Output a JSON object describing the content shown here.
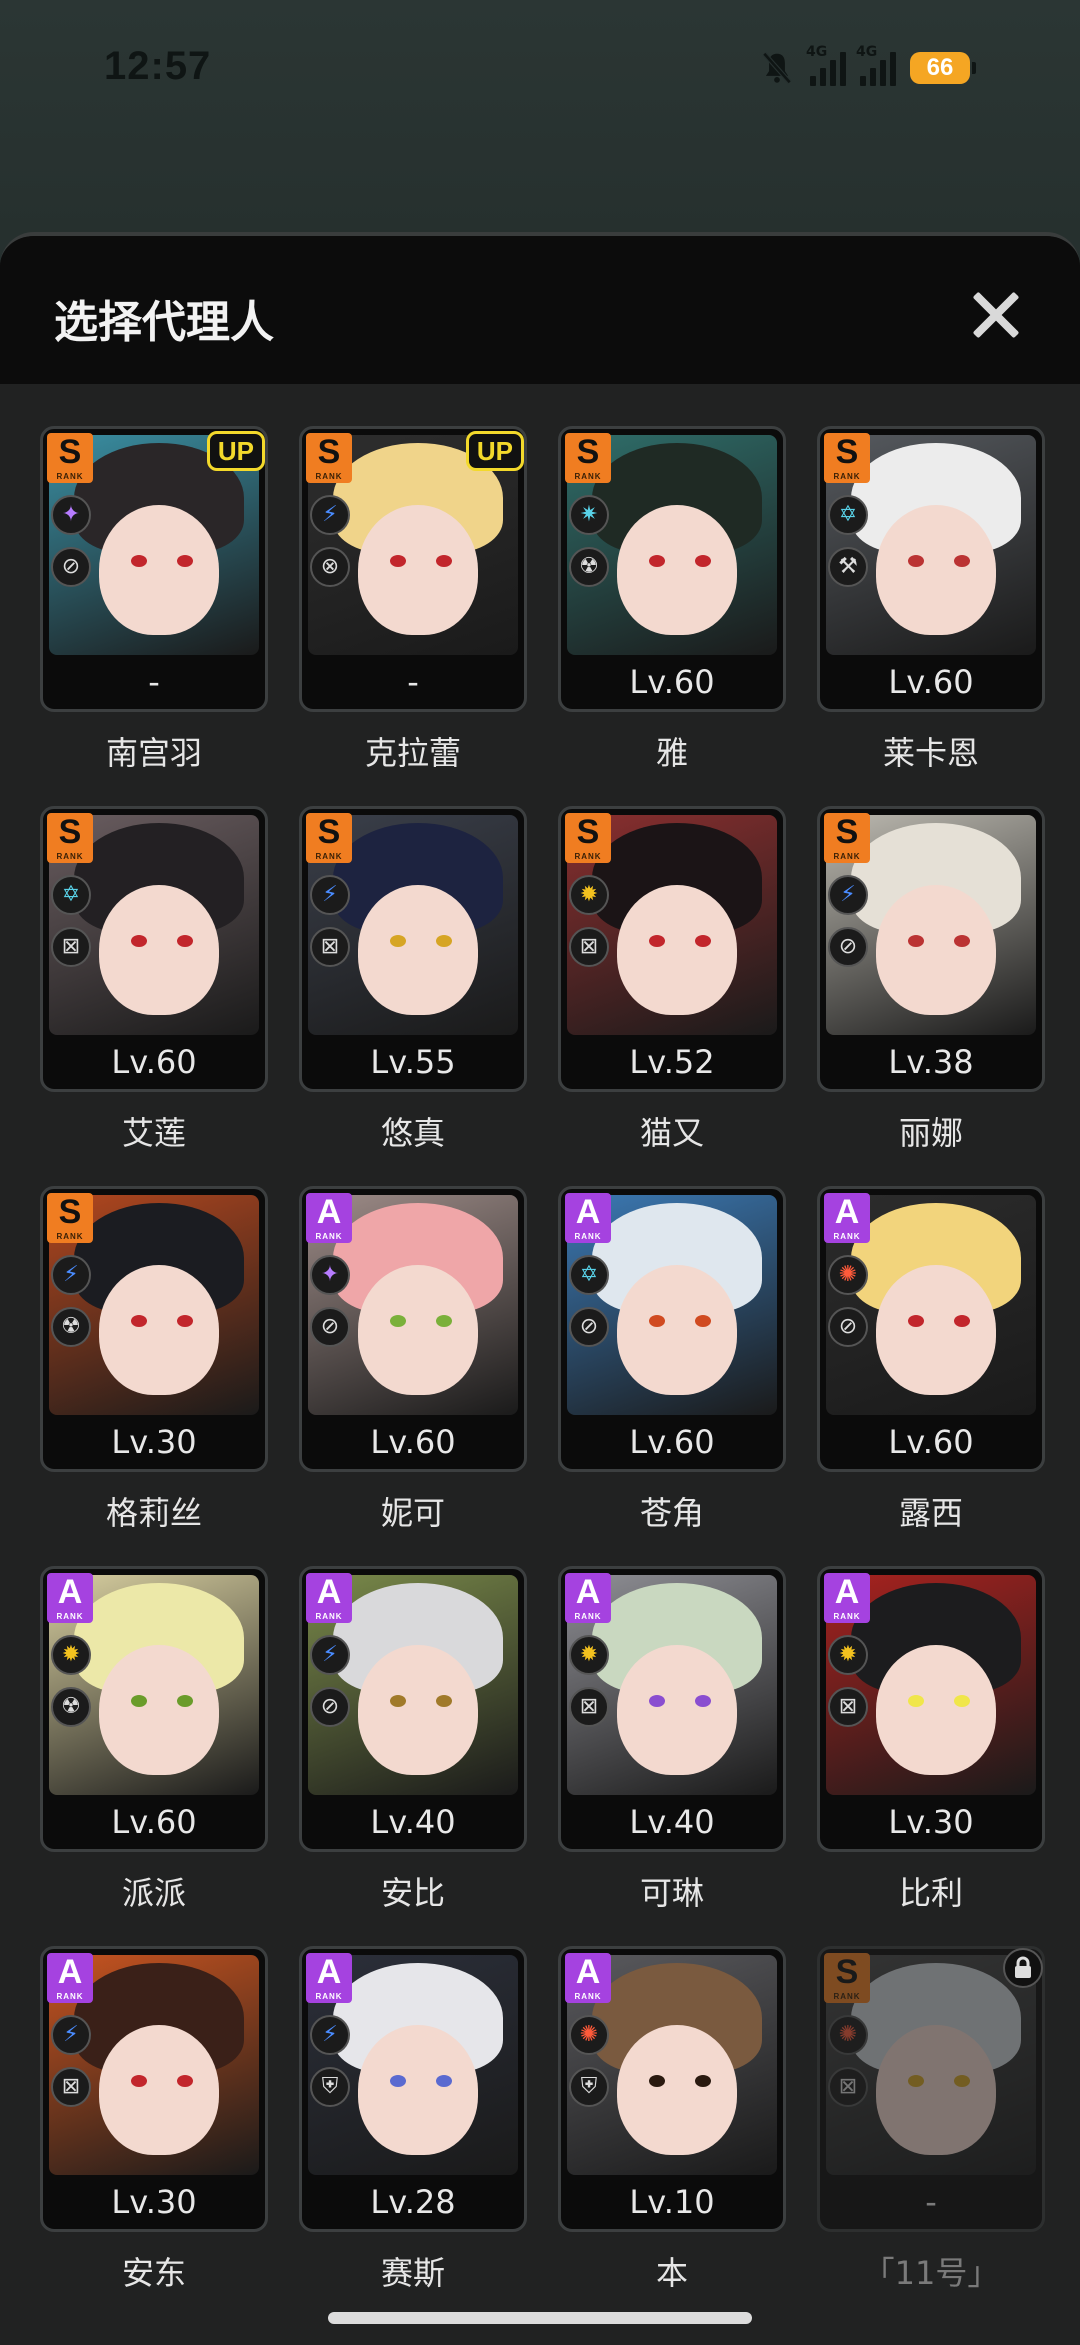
{
  "status_bar": {
    "time": "12:57",
    "network_1": "4G",
    "network_2": "4G",
    "battery": "66"
  },
  "panel": {
    "title": "选择代理人"
  },
  "agents": [
    {
      "name": "南宫羽",
      "level": "-",
      "rank": "S",
      "up": "UP",
      "attr_icon": "✦",
      "attr_color": "#b77cff",
      "spec_icon": "⊘",
      "hair": "#2a2628",
      "bg": "#3a8fa3",
      "eye": "#c2262c"
    },
    {
      "name": "克拉蕾",
      "level": "-",
      "rank": "S",
      "up": "UP",
      "attr_icon": "⚡",
      "attr_color": "#4a8cff",
      "spec_icon": "⊗",
      "hair": "#f0d48a",
      "bg": "#2e2e2e",
      "eye": "#c2262c"
    },
    {
      "name": "雅",
      "level": "Lv.60",
      "rank": "S",
      "attr_icon": "✷",
      "attr_color": "#59d2e8",
      "spec_icon": "☢",
      "hair": "#1f2a24",
      "bg": "#2f6e6a",
      "eye": "#c2262c"
    },
    {
      "name": "莱卡恩",
      "level": "Lv.60",
      "rank": "S",
      "attr_icon": "✡",
      "attr_color": "#59d2e8",
      "spec_icon": "⚒",
      "hair": "#ececec",
      "bg": "#565a5f",
      "eye": "#b33"
    },
    {
      "name": "艾莲",
      "level": "Lv.60",
      "rank": "S",
      "attr_icon": "✡",
      "attr_color": "#59d2e8",
      "spec_icon": "⊠",
      "hair": "#232023",
      "bg": "#6a5d60",
      "eye": "#c2262c"
    },
    {
      "name": "悠真",
      "level": "Lv.55",
      "rank": "S",
      "attr_icon": "⚡",
      "attr_color": "#4a8cff",
      "spec_icon": "⊠",
      "hair": "#1d2340",
      "bg": "#3a3f4a",
      "eye": "#d6a524"
    },
    {
      "name": "猫又",
      "level": "Lv.52",
      "rank": "S",
      "attr_icon": "✹",
      "attr_color": "#f3c21f",
      "spec_icon": "⊠",
      "hair": "#1b1416",
      "bg": "#8a2f2f",
      "eye": "#c2262c"
    },
    {
      "name": "丽娜",
      "level": "Lv.38",
      "rank": "S",
      "attr_icon": "⚡",
      "attr_color": "#4a8cff",
      "spec_icon": "⊘",
      "hair": "#e5e0d6",
      "bg": "#bcb9b0",
      "eye": "#b33"
    },
    {
      "name": "格莉丝",
      "level": "Lv.30",
      "rank": "S",
      "attr_icon": "⚡",
      "attr_color": "#4a8cff",
      "spec_icon": "☢",
      "hair": "#1b1c21",
      "bg": "#b2471f",
      "eye": "#c2262c"
    },
    {
      "name": "妮可",
      "level": "Lv.60",
      "rank": "A",
      "attr_icon": "✦",
      "attr_color": "#b77cff",
      "spec_icon": "⊘",
      "hair": "#efa6a8",
      "bg": "#9e8c88",
      "eye": "#7ab03a"
    },
    {
      "name": "苍角",
      "level": "Lv.60",
      "rank": "A",
      "attr_icon": "✡",
      "attr_color": "#59d2e8",
      "spec_icon": "⊘",
      "hair": "#dfe7ee",
      "bg": "#3b79b4",
      "eye": "#d04a20"
    },
    {
      "name": "露西",
      "level": "Lv.60",
      "rank": "A",
      "attr_icon": "✺",
      "attr_color": "#ff5a3a",
      "spec_icon": "⊘",
      "hair": "#f2d47c",
      "bg": "#2c2c2c",
      "eye": "#c2262c"
    },
    {
      "name": "派派",
      "level": "Lv.60",
      "rank": "A",
      "attr_icon": "✹",
      "attr_color": "#f3c21f",
      "spec_icon": "☢",
      "hair": "#ece8a8",
      "bg": "#d8cfa0",
      "eye": "#6a9c2a"
    },
    {
      "name": "安比",
      "level": "Lv.40",
      "rank": "A",
      "attr_icon": "⚡",
      "attr_color": "#4a8cff",
      "spec_icon": "⊘",
      "hair": "#d9d9db",
      "bg": "#7a8a4a",
      "eye": "#a07a2a"
    },
    {
      "name": "可琳",
      "level": "Lv.40",
      "rank": "A",
      "attr_icon": "✹",
      "attr_color": "#f3c21f",
      "spec_icon": "⊠",
      "hair": "#c9d8c0",
      "bg": "#8f8f95",
      "eye": "#8a4ed0"
    },
    {
      "name": "比利",
      "level": "Lv.30",
      "rank": "A",
      "attr_icon": "✹",
      "attr_color": "#f3c21f",
      "spec_icon": "⊠",
      "hair": "#1c1c1e",
      "bg": "#a8221f",
      "eye": "#f0e64a"
    },
    {
      "name": "安东",
      "level": "Lv.30",
      "rank": "A",
      "attr_icon": "⚡",
      "attr_color": "#4a8cff",
      "spec_icon": "⊠",
      "hair": "#3a2018",
      "bg": "#c85420",
      "eye": "#c2262c"
    },
    {
      "name": "赛斯",
      "level": "Lv.28",
      "rank": "A",
      "attr_icon": "⚡",
      "attr_color": "#4a8cff",
      "spec_icon": "⛨",
      "hair": "#e6e6ea",
      "bg": "#2b2f3a",
      "eye": "#5a6ad0"
    },
    {
      "name": "本",
      "level": "Lv.10",
      "rank": "A",
      "attr_icon": "✺",
      "attr_color": "#ff5a3a",
      "spec_icon": "⛨",
      "hair": "#7a5a3f",
      "bg": "#5a5a5e",
      "eye": "#2a1a10"
    },
    {
      "name": "「11号」",
      "level": "-",
      "rank": "S",
      "locked": true,
      "attr_icon": "✺",
      "attr_color": "#ff5a3a",
      "spec_icon": "⊠",
      "hair": "#cfd3d8",
      "bg": "#4a4a4a",
      "eye": "#d6a524"
    }
  ]
}
